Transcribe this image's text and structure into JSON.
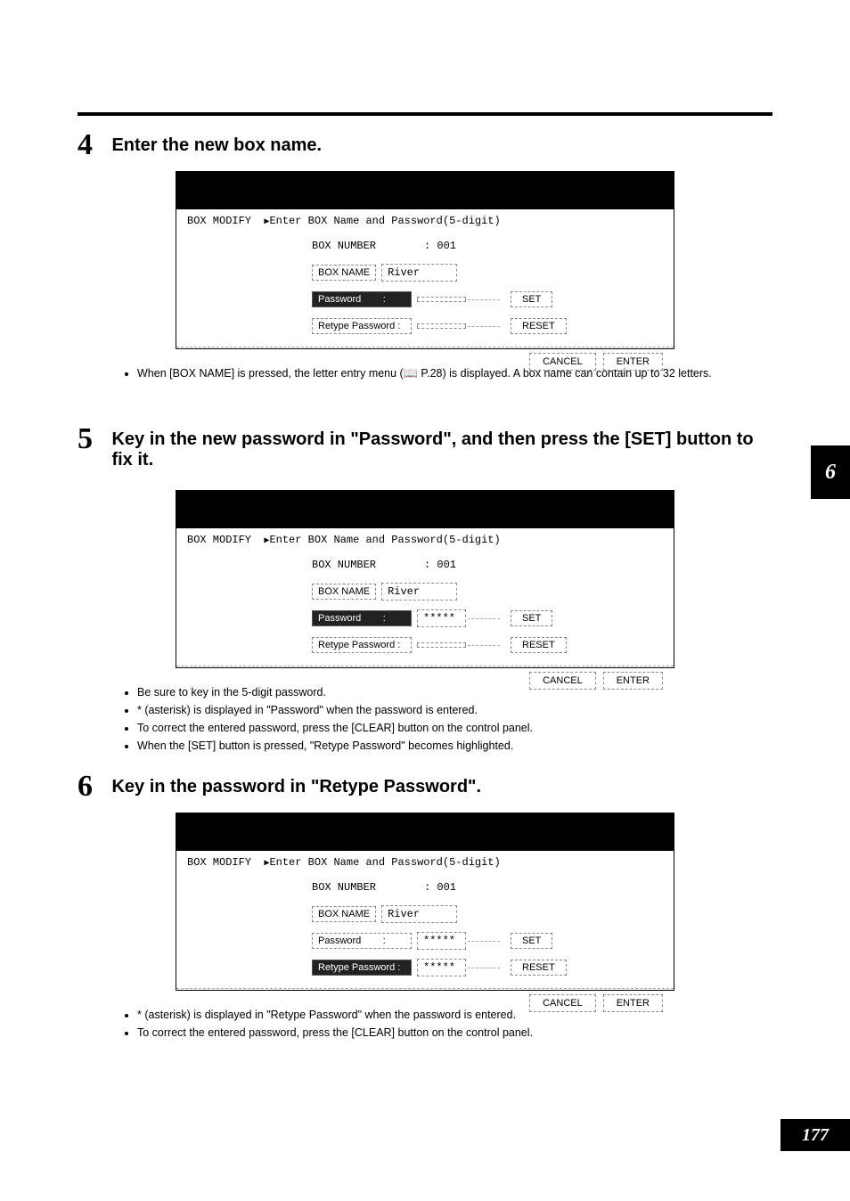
{
  "page": {
    "chapterTab": "6",
    "pageNumber": "177"
  },
  "steps": {
    "s4": {
      "num": "4",
      "title": "Enter the new box name."
    },
    "s5": {
      "num": "5",
      "title": "Key in the new password in \"Password\", and then press the [SET] button to fix it."
    },
    "s6": {
      "num": "6",
      "title": "Key in the password in \"Retype Password\"."
    }
  },
  "shot": {
    "promptLabel": "BOX MODIFY",
    "promptText": "Enter BOX Name and Password(5-digit)",
    "boxNumberLabel": "BOX NUMBER",
    "boxNumberValue": ": 001",
    "boxNameLabel": "BOX NAME",
    "boxNameValue": "River",
    "passwordLabel": "Password",
    "retypeLabel": "Retype Password",
    "colon": ":",
    "mask": "*****",
    "setBtn": "SET",
    "resetBtn": "RESET",
    "cancelBtn": "CANCEL",
    "enterBtn": "ENTER"
  },
  "notes4": {
    "b1a": "When [BOX NAME] is pressed, the letter entry menu (",
    "b1ref": " P.28",
    "b1b": ") is displayed. A box name can contain up to 32 letters."
  },
  "notes5": {
    "b1": "Be sure to key in the 5-digit password.",
    "b2": "* (asterisk) is displayed in \"Password\" when the password is entered.",
    "b3": "To correct the entered password, press the [CLEAR] button on the control panel.",
    "b4": "When the [SET] button is pressed, \"Retype Password\" becomes highlighted."
  },
  "notes6": {
    "b1": "* (asterisk) is displayed in \"Retype Password\" when the password is entered.",
    "b2": "To correct the entered password, press the [CLEAR] button on the control panel."
  }
}
